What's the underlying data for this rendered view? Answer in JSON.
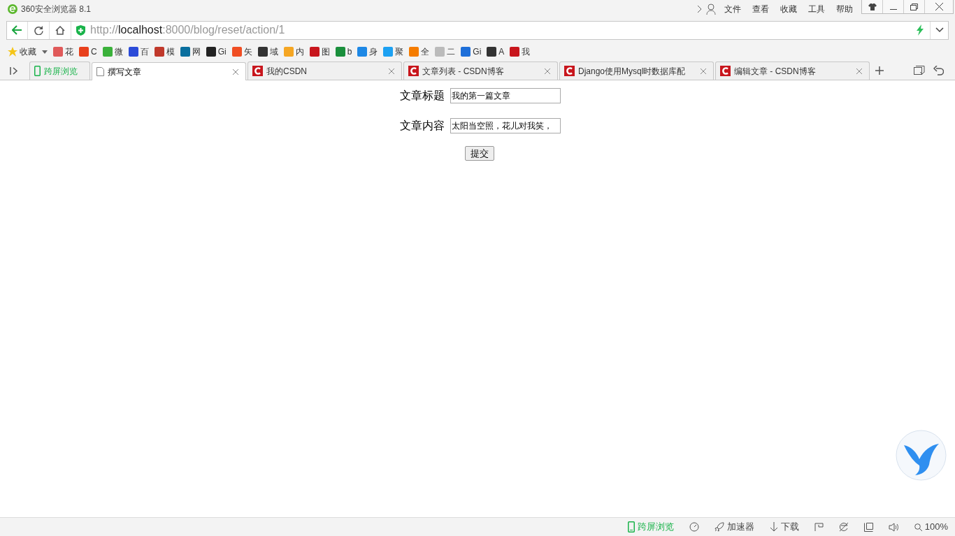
{
  "window": {
    "title": "360安全浏览器 8.1"
  },
  "menu": [
    "文件",
    "查看",
    "收藏",
    "工具",
    "帮助"
  ],
  "address_bar": {
    "url_scheme": "http://",
    "url_host": "localhost",
    "url_path": ":8000/blog/reset/action/1"
  },
  "bookmarks_label": "收藏",
  "bookmarks": [
    {
      "label": "花",
      "color": "#e05a5a"
    },
    {
      "label": "C",
      "color": "#e8401c"
    },
    {
      "label": "微",
      "color": "#3bb13b"
    },
    {
      "label": "百",
      "color": "#2b4bd8"
    },
    {
      "label": "模",
      "color": "#c0392b"
    },
    {
      "label": "网",
      "color": "#0a6f9e"
    },
    {
      "label": "Gi",
      "color": "#222222"
    },
    {
      "label": "矢",
      "color": "#f04e23"
    },
    {
      "label": "域",
      "color": "#333333"
    },
    {
      "label": "内",
      "color": "#f5a623"
    },
    {
      "label": "图",
      "color": "#c8161d"
    },
    {
      "label": "b",
      "color": "#1a8f3c"
    },
    {
      "label": "身",
      "color": "#1e88e5"
    },
    {
      "label": "聚",
      "color": "#1da1f2"
    },
    {
      "label": "全",
      "color": "#f57c00"
    },
    {
      "label": "二",
      "color": "#bbbbbb"
    },
    {
      "label": "Gi",
      "color": "#1e6fd9"
    },
    {
      "label": "A",
      "color": "#333333"
    },
    {
      "label": "我",
      "color": "#c8161d"
    }
  ],
  "tabs": [
    {
      "kind": "cross-screen",
      "label": "跨屏浏览",
      "selected": false
    },
    {
      "kind": "blank",
      "label": "撰写文章",
      "selected": true
    },
    {
      "kind": "csdn",
      "label": "我的CSDN",
      "selected": false
    },
    {
      "kind": "csdn",
      "label": "文章列表 - CSDN博客",
      "selected": false
    },
    {
      "kind": "csdn",
      "label": "Django使用Mysql时数据库配",
      "selected": false
    },
    {
      "kind": "csdn",
      "label": "编辑文章 - CSDN博客",
      "selected": false
    }
  ],
  "form": {
    "fields": [
      {
        "label": "文章标题",
        "value": "我的第一篇文章"
      },
      {
        "label": "文章内容",
        "value": "太阳当空照，花儿对我笑，"
      }
    ],
    "submit": "提交"
  },
  "status_bar": {
    "cross_screen": "跨屏浏览",
    "accelerator": "加速器",
    "download": "下载",
    "zoom": "100%"
  }
}
